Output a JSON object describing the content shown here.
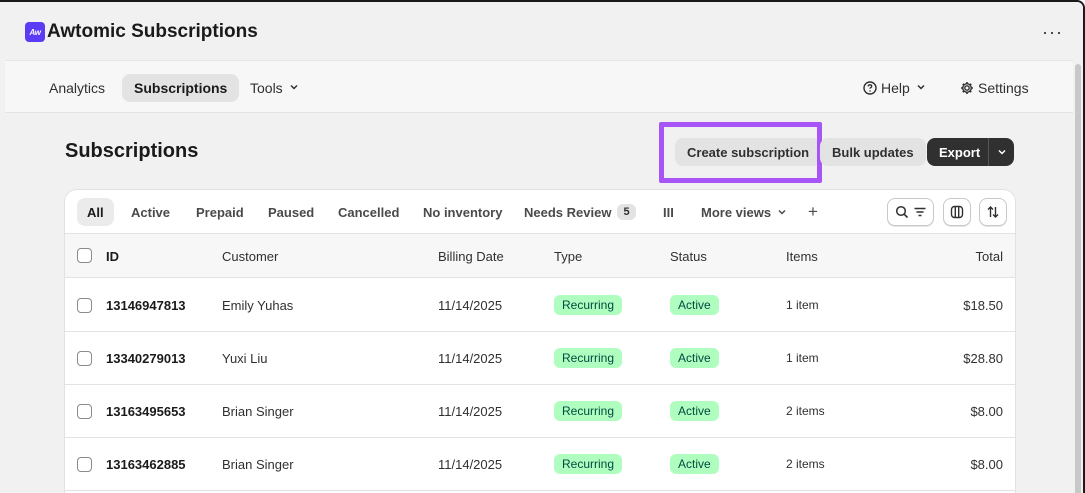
{
  "app": {
    "logo_text": "Aw",
    "title": "Awtomic Subscriptions",
    "more_menu": "···"
  },
  "nav": {
    "items": [
      {
        "label": "Analytics"
      },
      {
        "label": "Subscriptions"
      },
      {
        "label": "Tools"
      }
    ],
    "help_label": "Help",
    "settings_label": "Settings"
  },
  "page": {
    "title": "Subscriptions",
    "create_button": "Create subscription",
    "bulk_button": "Bulk updates",
    "export_button": "Export"
  },
  "tabs": [
    {
      "label": "All"
    },
    {
      "label": "Active"
    },
    {
      "label": "Prepaid"
    },
    {
      "label": "Paused"
    },
    {
      "label": "Cancelled"
    },
    {
      "label": "No inventory"
    },
    {
      "label": "Needs Review",
      "badge": "5"
    },
    {
      "label": "III"
    },
    {
      "label": "More views"
    },
    {
      "label": "+"
    }
  ],
  "table": {
    "columns": [
      "ID",
      "Customer",
      "Billing Date",
      "Type",
      "Status",
      "Items",
      "Total"
    ],
    "rows": [
      {
        "id": "13146947813",
        "customer": "Emily Yuhas",
        "billing_date": "11/14/2025",
        "type": "Recurring",
        "status": "Active",
        "items": "1 item",
        "total": "$18.50"
      },
      {
        "id": "13340279013",
        "customer": "Yuxi Liu",
        "billing_date": "11/14/2025",
        "type": "Recurring",
        "status": "Active",
        "items": "1 item",
        "total": "$28.80"
      },
      {
        "id": "13163495653",
        "customer": "Brian Singer",
        "billing_date": "11/14/2025",
        "type": "Recurring",
        "status": "Active",
        "items": "2 items",
        "total": "$8.00"
      },
      {
        "id": "13163462885",
        "customer": "Brian Singer",
        "billing_date": "11/14/2025",
        "type": "Recurring",
        "status": "Active",
        "items": "2 items",
        "total": "$8.00"
      }
    ]
  },
  "colors": {
    "brand": "#5b3bf6",
    "highlight": "#a855f7",
    "pill_bg": "#affebf",
    "pill_text": "#014b40"
  }
}
